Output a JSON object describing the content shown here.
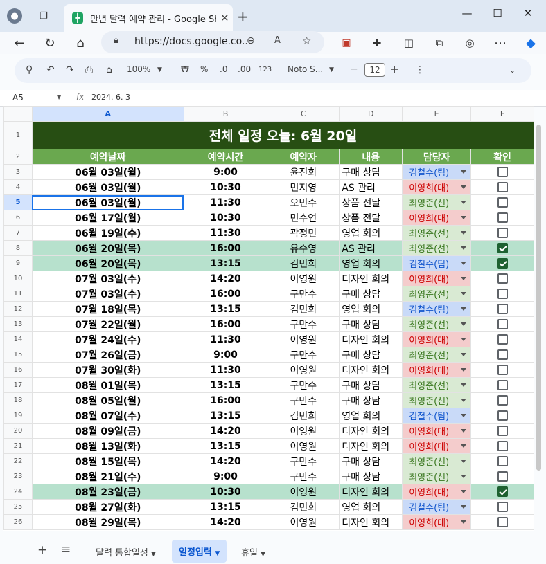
{
  "browser": {
    "tab_title": "만년 달력 예약 관리 - Google Sheets",
    "url": "https://docs.google.co..."
  },
  "toolbar": {
    "zoom": "100%",
    "currency": "₩",
    "percent": "%",
    "dec_dec": ".0",
    "dec_inc": ".00",
    "num_fmt": "123",
    "font": "Noto S...",
    "font_size": "12",
    "minus": "−",
    "plus": "+"
  },
  "formula_bar": {
    "cell_ref": "A5",
    "fx": "fx",
    "value": "2024. 6. 3"
  },
  "columns": [
    "A",
    "B",
    "C",
    "D",
    "E",
    "F"
  ],
  "sheet": {
    "title": "전체 일정 오늘: 6월 20일",
    "headers": [
      "예약날짜",
      "예약시간",
      "예약자",
      "내용",
      "담당자",
      "확인"
    ],
    "rows": [
      {
        "n": "3",
        "date": "06월 03일(월)",
        "time": "9:00",
        "person": "윤진희",
        "content": "구매 상담",
        "staff": "김철수(팀)",
        "checked": false
      },
      {
        "n": "4",
        "date": "06월 03일(월)",
        "time": "10:30",
        "person": "민지영",
        "content": "AS 관리",
        "staff": "이영희(대)",
        "checked": false
      },
      {
        "n": "5",
        "date": "06월 03일(월)",
        "time": "11:30",
        "person": "오민수",
        "content": "상품 전달",
        "staff": "최영준(선)",
        "checked": false
      },
      {
        "n": "6",
        "date": "06월 17일(월)",
        "time": "10:30",
        "person": "민수연",
        "content": "상품 전달",
        "staff": "이영희(대)",
        "checked": false
      },
      {
        "n": "7",
        "date": "06월 19일(수)",
        "time": "11:30",
        "person": "곽정민",
        "content": "영업 회의",
        "staff": "최영준(선)",
        "checked": false
      },
      {
        "n": "8",
        "date": "06월 20일(목)",
        "time": "16:00",
        "person": "유수영",
        "content": "AS 관리",
        "staff": "최영준(선)",
        "checked": true
      },
      {
        "n": "9",
        "date": "06월 20일(목)",
        "time": "13:15",
        "person": "김민희",
        "content": "영업 회의",
        "staff": "김철수(팀)",
        "checked": true
      },
      {
        "n": "10",
        "date": "07월 03일(수)",
        "time": "14:20",
        "person": "이영원",
        "content": "디자인 회의",
        "staff": "이영희(대)",
        "checked": false
      },
      {
        "n": "11",
        "date": "07월 03일(수)",
        "time": "16:00",
        "person": "구만수",
        "content": "구매 상담",
        "staff": "최영준(선)",
        "checked": false
      },
      {
        "n": "12",
        "date": "07월 18일(목)",
        "time": "13:15",
        "person": "김민희",
        "content": "영업 회의",
        "staff": "김철수(팀)",
        "checked": false
      },
      {
        "n": "13",
        "date": "07월 22일(월)",
        "time": "16:00",
        "person": "구만수",
        "content": "구매 상담",
        "staff": "최영준(선)",
        "checked": false
      },
      {
        "n": "14",
        "date": "07월 24일(수)",
        "time": "11:30",
        "person": "이영원",
        "content": "디자인 회의",
        "staff": "이영희(대)",
        "checked": false
      },
      {
        "n": "15",
        "date": "07월 26일(금)",
        "time": "9:00",
        "person": "구만수",
        "content": "구매 상담",
        "staff": "최영준(선)",
        "checked": false
      },
      {
        "n": "16",
        "date": "07월 30일(화)",
        "time": "11:30",
        "person": "이영원",
        "content": "디자인 회의",
        "staff": "이영희(대)",
        "checked": false
      },
      {
        "n": "17",
        "date": "08월 01일(목)",
        "time": "13:15",
        "person": "구만수",
        "content": "구매 상담",
        "staff": "최영준(선)",
        "checked": false
      },
      {
        "n": "18",
        "date": "08월 05일(월)",
        "time": "16:00",
        "person": "구만수",
        "content": "구매 상담",
        "staff": "최영준(선)",
        "checked": false
      },
      {
        "n": "19",
        "date": "08월 07일(수)",
        "time": "13:15",
        "person": "김민희",
        "content": "영업 회의",
        "staff": "김철수(팀)",
        "checked": false
      },
      {
        "n": "20",
        "date": "08월 09일(금)",
        "time": "14:20",
        "person": "이영원",
        "content": "디자인 회의",
        "staff": "이영희(대)",
        "checked": false
      },
      {
        "n": "21",
        "date": "08월 13일(화)",
        "time": "13:15",
        "person": "이영원",
        "content": "디자인 회의",
        "staff": "이영희(대)",
        "checked": false
      },
      {
        "n": "22",
        "date": "08월 15일(목)",
        "time": "14:20",
        "person": "구만수",
        "content": "구매 상담",
        "staff": "최영준(선)",
        "checked": false
      },
      {
        "n": "23",
        "date": "08월 21일(수)",
        "time": "9:00",
        "person": "구만수",
        "content": "구매 상담",
        "staff": "최영준(선)",
        "checked": false
      },
      {
        "n": "24",
        "date": "08월 23일(금)",
        "time": "10:30",
        "person": "이영원",
        "content": "디자인 회의",
        "staff": "이영희(대)",
        "checked": true
      },
      {
        "n": "25",
        "date": "08월 27일(화)",
        "time": "13:15",
        "person": "김민희",
        "content": "영업 회의",
        "staff": "김철수(팀)",
        "checked": false
      },
      {
        "n": "26",
        "date": "08월 29일(목)",
        "time": "14:20",
        "person": "이영원",
        "content": "디자인 회의",
        "staff": "이영희(대)",
        "checked": false
      }
    ]
  },
  "staff_colors": {
    "김철수(팀)": "#c9daf8",
    "이영희(대)": "#f4cccc",
    "최영준(선)": "#d9ead3"
  },
  "staff_text_colors": {
    "김철수(팀)": "#1155cc",
    "이영희(대)": "#cc0000",
    "최영준(선)": "#38761d"
  },
  "sheet_tabs": [
    "달력 통합일정",
    "일정입력",
    "휴일"
  ],
  "active_tab": "일정입력"
}
